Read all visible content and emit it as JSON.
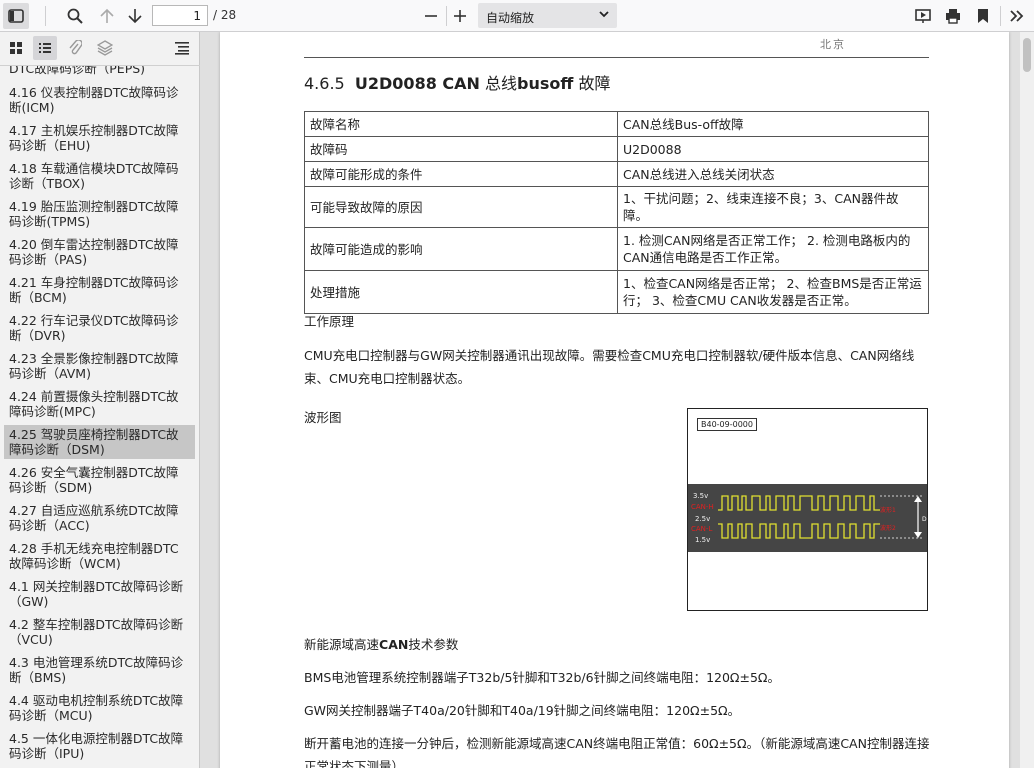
{
  "toolbar": {
    "page_current": "1",
    "page_total": "/ 28",
    "zoom_label": "自动缩放"
  },
  "sidebar": {
    "items": [
      {
        "label": "DTC故障码诊断（PEPS)"
      },
      {
        "label": "4.16 仪表控制器DTC故障码诊断(ICM)"
      },
      {
        "label": "4.17 主机娱乐控制器DTC故障码诊断（EHU)"
      },
      {
        "label": "4.18 车载通信模块DTC故障码诊断（TBOX)"
      },
      {
        "label": "4.19 胎压监测控制器DTC故障码诊断(TPMS)"
      },
      {
        "label": "4.20 倒车雷达控制器DTC故障码诊断（PAS)"
      },
      {
        "label": "4.21 车身控制器DTC故障码诊断（BCM)"
      },
      {
        "label": "4.22 行车记录仪DTC故障码诊断（DVR)"
      },
      {
        "label": "4.23 全景影像控制器DTC故障码诊断（AVM)"
      },
      {
        "label": "4.24 前置摄像头控制器DTC故障码诊断(MPC)"
      },
      {
        "label": "4.25 驾驶员座椅控制器DTC故障码诊断（DSM)",
        "selected": true
      },
      {
        "label": "4.26 安全气囊控制器DTC故障码诊断（SDM)"
      },
      {
        "label": "4.27 自适应巡航系统DTC故障码诊断（ACC)"
      },
      {
        "label": "4.28 手机无线充电控制器DTC故障码诊断（WCM)"
      },
      {
        "label": "4.1 网关控制器DTC故障码诊断（GW)"
      },
      {
        "label": "4.2 整车控制器DTC故障码诊断（VCU)"
      },
      {
        "label": "4.3 电池管理系统DTC故障码诊断（BMS)"
      },
      {
        "label": "4.4 驱动电机控制系统DTC故障码诊断（MCU)"
      },
      {
        "label": "4.5 一体化电源控制器DTC故障码诊断（IPU)"
      }
    ]
  },
  "doc": {
    "header_logo": "北京",
    "section_num": "4.6.5",
    "section_code": "U2D0088 CAN",
    "section_mid": "总线",
    "section_bold2": "busoff",
    "section_tail": "故障",
    "table": [
      {
        "k": "故障名称",
        "v": "CAN总线Bus-off故障"
      },
      {
        "k": "故障码",
        "v": "U2D0088"
      },
      {
        "k": "故障可能形成的条件",
        "v": "CAN总线进入总线关闭状态"
      },
      {
        "k": "可能导致故障的原因",
        "v": "1、干扰问题；2、线束连接不良；3、CAN器件故障。"
      },
      {
        "k": "故障可能造成的影响",
        "v": "1. 检测CAN网络是否正常工作； 2. 检测电路板内的CAN通信电路是否工作正常。"
      },
      {
        "k": "处理措施",
        "v": "1、检查CAN网络是否正常； 2、检查BMS是否正常运行； 3、检查CMU CAN收发器是否正常。"
      }
    ],
    "work_title": "工作原理",
    "work_text": "CMU充电口控制器与GW网关控制器通讯出现故障。需要检查CMU充电口控制器软/硬件版本信息、CAN网络线束、CMU充电口控制器状态。",
    "wave_title": "波形图",
    "wave_tag": "B40-09-0000",
    "wave_v1": "3.5v",
    "wave_v2": "2.5v",
    "wave_v3": "1.5v",
    "wave_canh": "CAN-H",
    "wave_canl": "CAN-L",
    "wave_r1": "波形1",
    "wave_r2": "波形2",
    "wave_d": "D",
    "param_title_pre": "新能源域高速",
    "param_title_bold": "CAN",
    "param_title_post": "技术参数",
    "p1": "BMS电池管理系统控制器端子T32b/5针脚和T32b/6针脚之间终端电阻：120Ω±5Ω。",
    "p2": "GW网关控制器端子T40a/20针脚和T40a/19针脚之间终端电阻：120Ω±5Ω。",
    "p3": "断开蓄电池的连接一分钟后，检测新能源域高速CAN终端电阻正常值：60Ω±5Ω。（新能源域高速CAN控制器连接正常状态下测量）"
  }
}
